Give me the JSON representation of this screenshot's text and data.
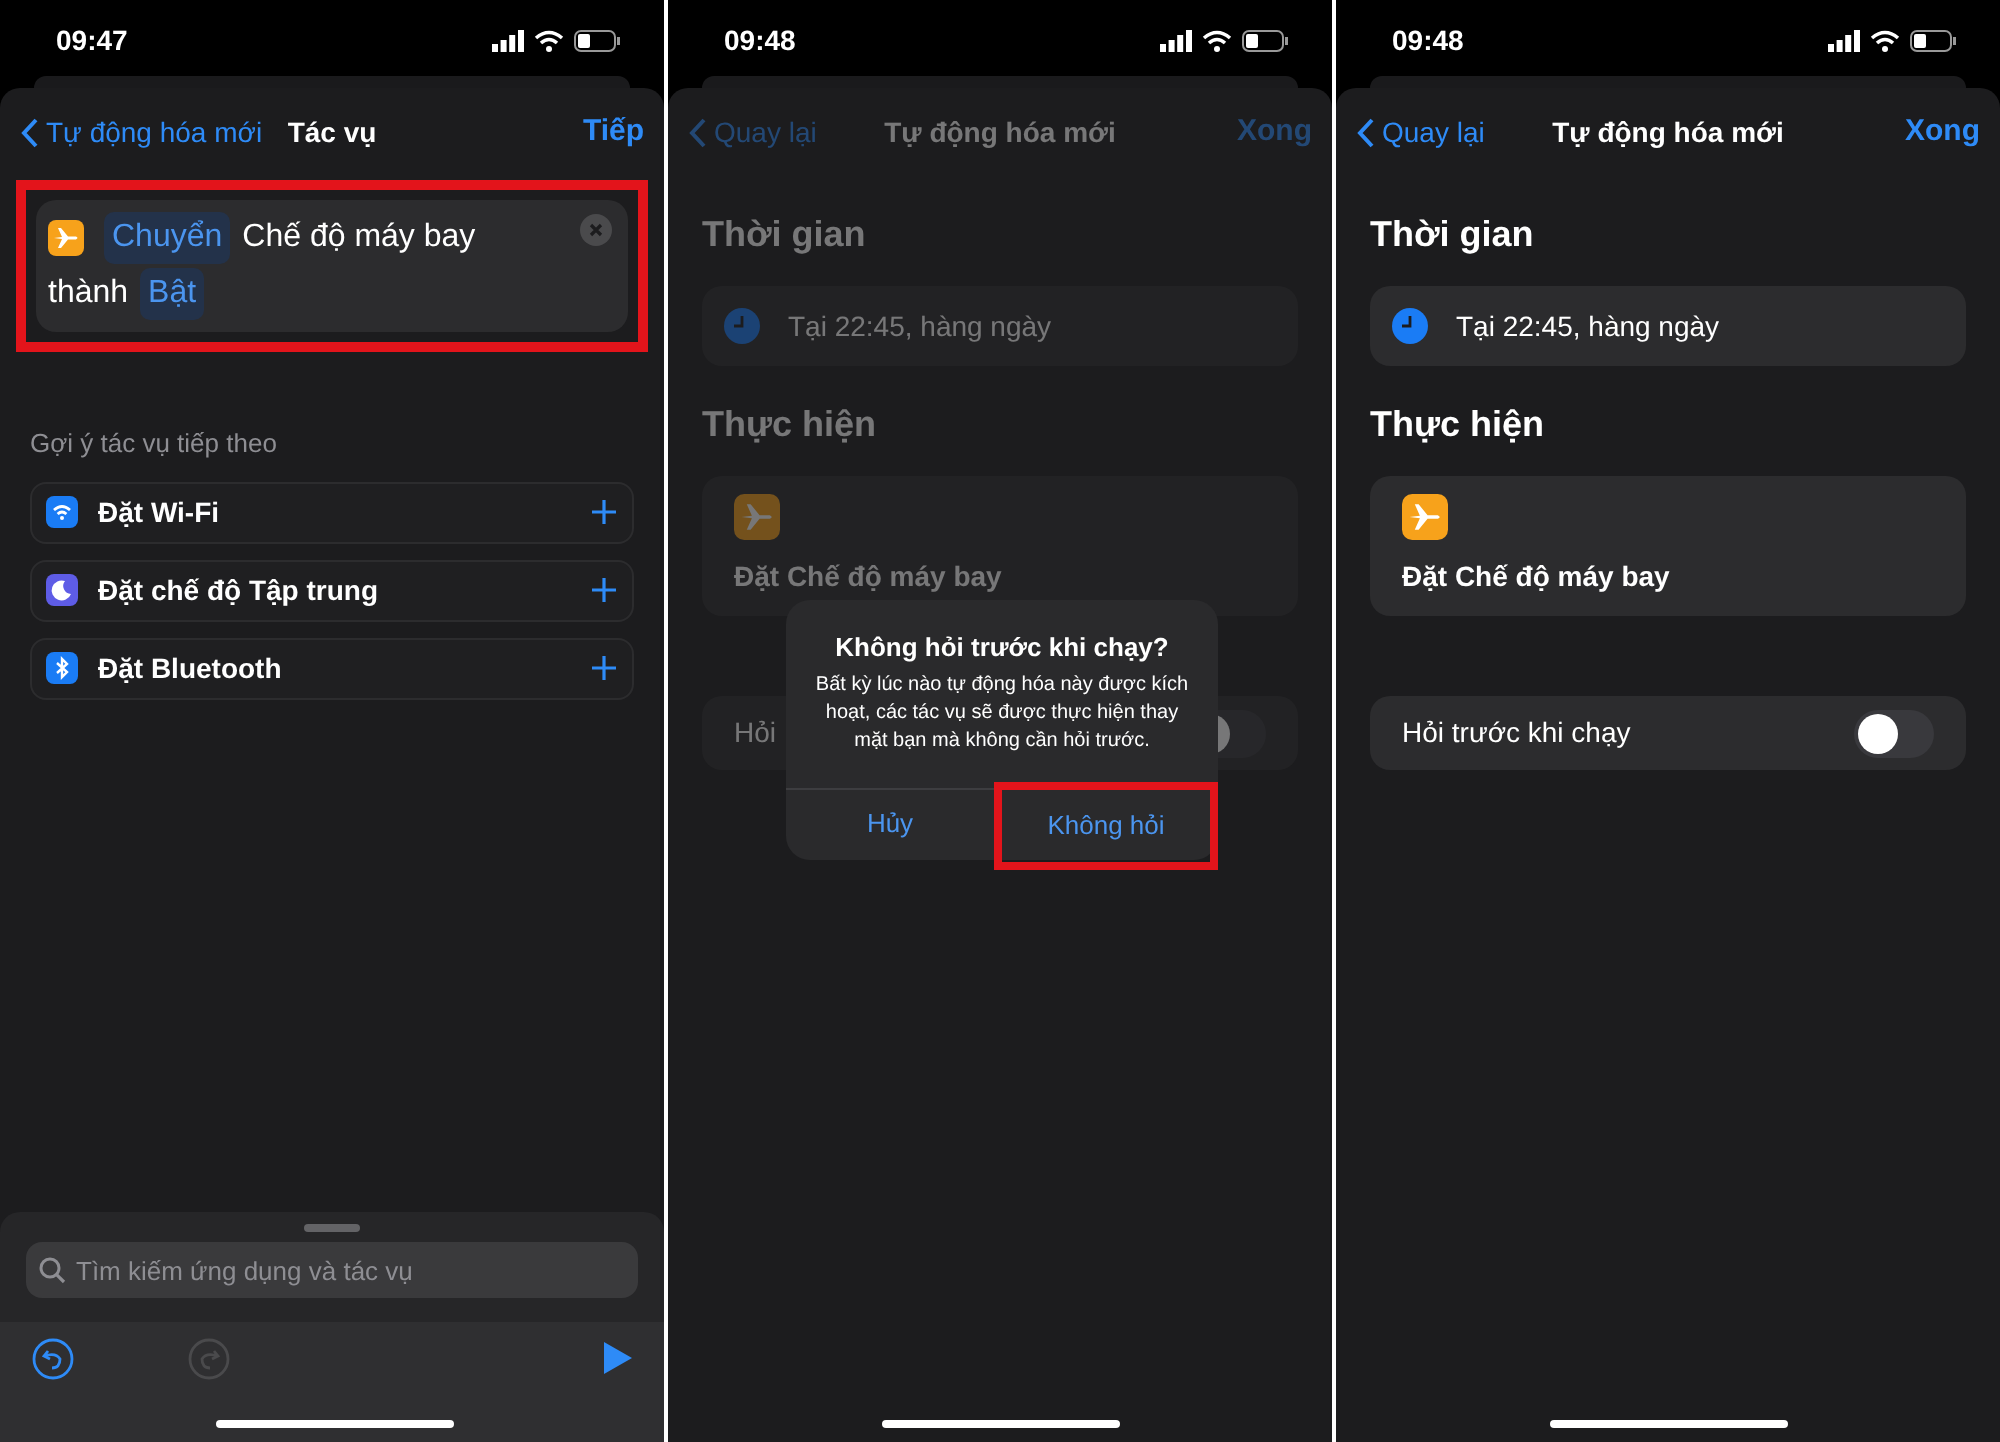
{
  "screens": [
    {
      "kind": "editor",
      "dimmed": false,
      "time": "09:47",
      "nav": {
        "back": "Tự động hóa mới",
        "title": "Tác vụ",
        "action": "Tiếp"
      },
      "action_card": {
        "highlighted": true,
        "parts": [
          {
            "kind": "token",
            "text": "Chuyển"
          },
          {
            "kind": "plain",
            "text": "Chế độ máy bay"
          },
          {
            "kind": "plain",
            "text": "thành"
          },
          {
            "kind": "token",
            "text": "Bật"
          }
        ]
      },
      "suggestions": {
        "heading": "Gợi ý tác vụ tiếp theo",
        "items": [
          {
            "kind": "wifi",
            "label": "Đặt Wi-Fi",
            "color": "#1a7cf5"
          },
          {
            "kind": "focus",
            "label": "Đặt chế độ Tập trung",
            "color": "#5e5ce6"
          },
          {
            "kind": "bluetooth",
            "label": "Đặt Bluetooth",
            "color": "#1a7cf5"
          }
        ]
      },
      "search": {
        "placeholder": "Tìm kiếm ứng dụng và tác vụ"
      },
      "toolbar": {
        "undo_disabled": false,
        "redo_disabled": true
      }
    },
    {
      "kind": "automation",
      "dimmed": true,
      "time": "09:48",
      "nav": {
        "back": "Quay lại",
        "title": "Tự động hóa mới",
        "action": "Xong"
      },
      "sections": [
        {
          "heading": "Thời gian",
          "kind": "time",
          "text": "Tại 22:45, hàng ngày"
        },
        {
          "heading": "Thực hiện",
          "kind": "action",
          "text": "Đặt Chế độ máy bay"
        }
      ],
      "toggle_row": {
        "label": "Hỏi",
        "on": false
      },
      "dialog": {
        "title": "Không hỏi trước khi chạy?",
        "message": "Bất kỳ lúc nào tự động hóa này được kích hoạt, các tác vụ sẽ được thực hiện thay mặt bạn mà không cần hỏi trước.",
        "buttons": [
          {
            "label": "Hủy",
            "highlighted": false
          },
          {
            "label": "Không hỏi",
            "highlighted": true
          }
        ]
      }
    },
    {
      "kind": "automation",
      "dimmed": false,
      "time": "09:48",
      "nav": {
        "back": "Quay lại",
        "title": "Tự động hóa mới",
        "action": "Xong"
      },
      "sections": [
        {
          "heading": "Thời gian",
          "kind": "time",
          "text": "Tại 22:45, hàng ngày"
        },
        {
          "heading": "Thực hiện",
          "kind": "action",
          "text": "Đặt Chế độ máy bay"
        }
      ],
      "toggle_row": {
        "label": "Hỏi trước khi chạy",
        "on": false
      }
    }
  ]
}
